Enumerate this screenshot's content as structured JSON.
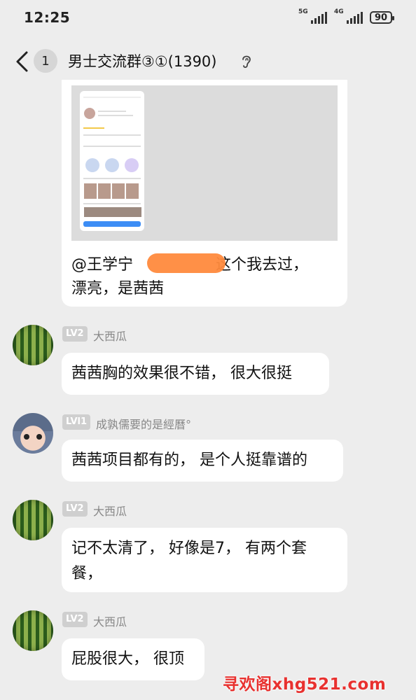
{
  "status_bar": {
    "time": "12:25",
    "signal_1": "5G",
    "signal_2": "4G",
    "battery": "90"
  },
  "nav": {
    "unread_count": "1",
    "title": "男士交流群③①(1390)"
  },
  "messages": [
    {
      "type": "image_and_text",
      "text_prefix": "@王学宁",
      "text_suffix": "这个我去过，",
      "text_line2": "漂亮，是茜茜"
    },
    {
      "level": "LV2",
      "nickname": "大西瓜",
      "text": "茜茜胸的效果很不错， 很大很挺"
    },
    {
      "level": "LVl1",
      "nickname": "成孰儒要的是經曆°",
      "text": "茜茜项目都有的， 是个人挺靠谱的"
    },
    {
      "level": "LV2",
      "nickname": "大西瓜",
      "text_line1": "记不太清了， 好像是7， 有两个套",
      "text_line2": "餐，"
    },
    {
      "level": "LV2",
      "nickname": "大西瓜",
      "text": "屁股很大， 很顶"
    }
  ],
  "watermark": "寻欢阁xhg521.com",
  "colors": {
    "background": "#ededed",
    "bubble": "#ffffff",
    "redaction": "#ff8a3d",
    "watermark": "#e8312f"
  }
}
